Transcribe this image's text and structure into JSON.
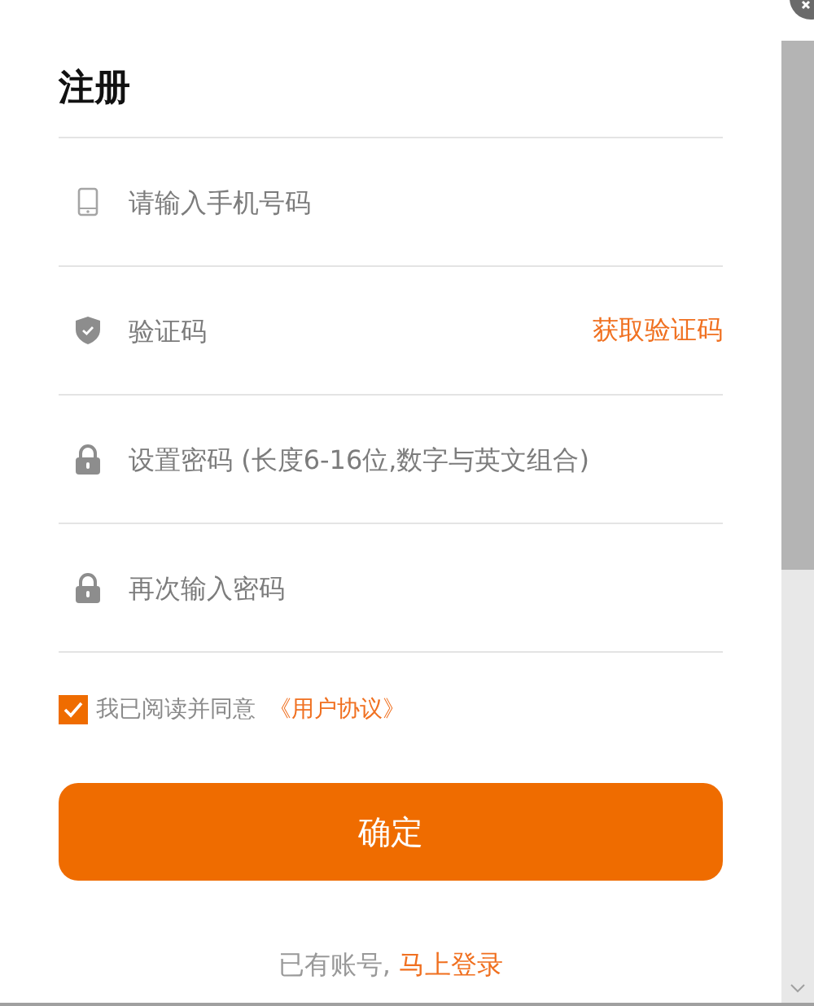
{
  "title": "注册",
  "fields": [
    {
      "kind": "phone",
      "placeholder": "请输入手机号码"
    },
    {
      "kind": "code",
      "placeholder": "验证码",
      "action": "获取验证码"
    },
    {
      "kind": "password",
      "placeholder": "设置密码 (长度6-16位,数字与英文组合)"
    },
    {
      "kind": "password",
      "placeholder": "再次输入密码"
    }
  ],
  "agreement": {
    "checked": true,
    "label": "我已阅读并同意",
    "link": "《用户协议》"
  },
  "submit": "确定",
  "footer": {
    "text": "已有账号,",
    "link": "马上登录"
  }
}
